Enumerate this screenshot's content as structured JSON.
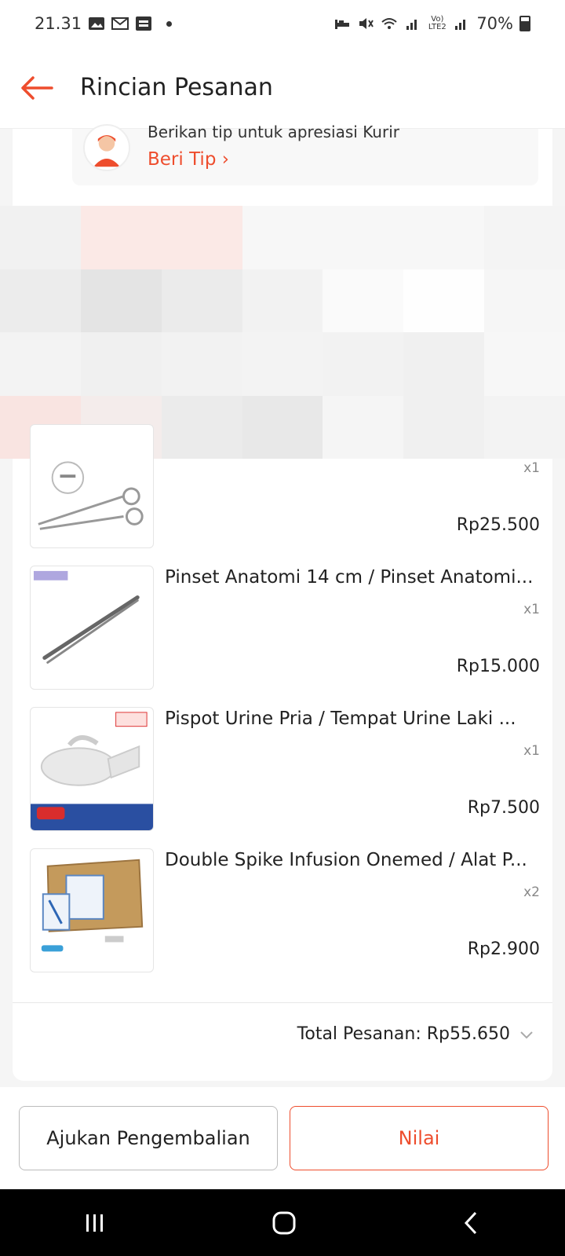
{
  "status": {
    "time": "21.31",
    "battery": "70%",
    "lte": "Vo) LTE2"
  },
  "appbar": {
    "title": "Rincian Pesanan"
  },
  "tip": {
    "text": "Berikan tip untuk apresiasi Kurir",
    "link": "Beri Tip"
  },
  "items": [
    {
      "name": "",
      "qty": "x1",
      "price": "Rp25.500",
      "icon": "scissors-icon"
    },
    {
      "name": "Pinset Anatomi 14 cm / Pinset Anatomi...",
      "qty": "x1",
      "price": "Rp15.000",
      "icon": "tweezers-icon"
    },
    {
      "name": "Pispot Urine Pria / Tempat Urine Laki ...",
      "qty": "x1",
      "price": "Rp7.500",
      "icon": "urinal-icon"
    },
    {
      "name": "Double Spike Infusion Onemed / Alat P...",
      "qty": "x2",
      "price": "Rp2.900",
      "icon": "box-icon"
    }
  ],
  "total": {
    "label": "Total Pesanan: Rp55.650"
  },
  "buttons": {
    "return": "Ajukan Pengembalian",
    "rate": "Nilai"
  },
  "colors": {
    "accent": "#ee4d2d"
  }
}
